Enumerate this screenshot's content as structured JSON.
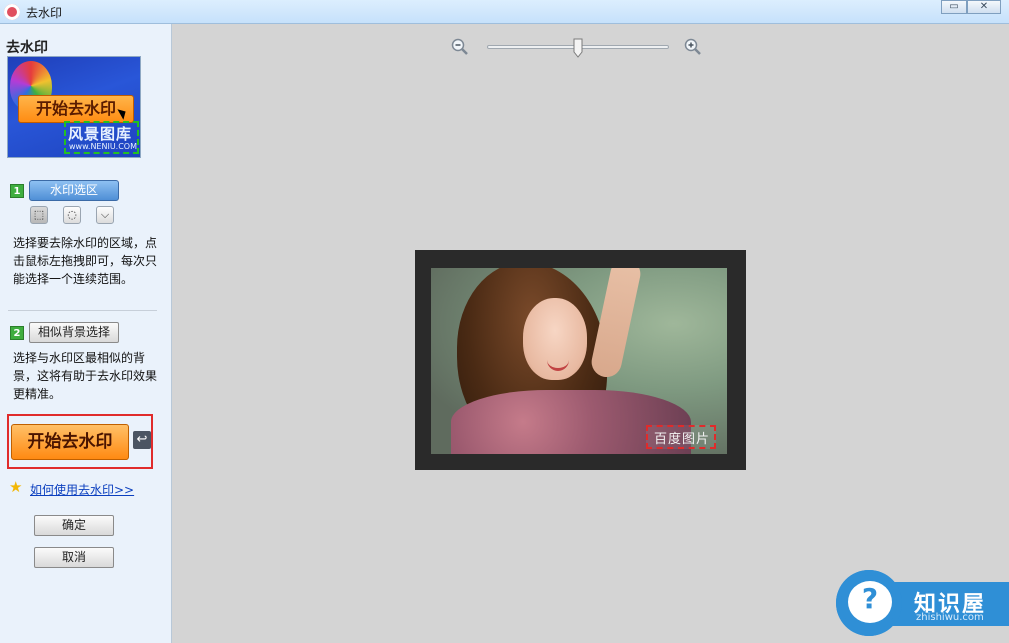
{
  "window": {
    "title": "去水印",
    "btn_restore": "▭",
    "btn_close": "✕"
  },
  "sidebar": {
    "title": "去水印",
    "preview": {
      "button_label": "开始去水印",
      "watermark_text": "风景图库",
      "watermark_sub": "www.NENIU.COM"
    },
    "step1": {
      "number": "1",
      "button_label": "水印选区",
      "tools": [
        "rect-select",
        "lasso-select",
        "polygon-select"
      ],
      "description": "选择要去除水印的区域，点击鼠标左拖拽即可，每次只能选择一个连续范围。"
    },
    "step2": {
      "number": "2",
      "button_label": "相似背景选择",
      "description": "选择与水印区最相似的背景，这将有助于去水印效果更精准。"
    },
    "start_button": "开始去水印",
    "help_link": "如何使用去水印>>",
    "ok_button": "确定",
    "cancel_button": "取消"
  },
  "canvas": {
    "zoom_level_fraction": 0.5,
    "watermark_text": "百度图片"
  },
  "brand": {
    "name": "知识屋",
    "url": "zhishiwu.com",
    "color": "#2f8fd6"
  }
}
